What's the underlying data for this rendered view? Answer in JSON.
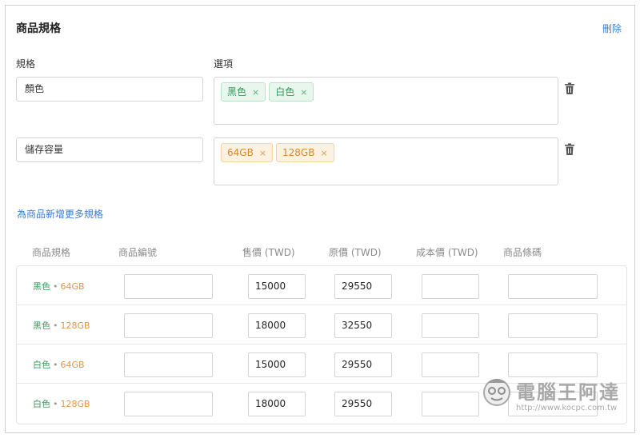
{
  "section": {
    "title": "商品規格",
    "delete_label": "刪除"
  },
  "labels": {
    "spec": "規格",
    "options": "選項"
  },
  "specs": [
    {
      "name": "顏色",
      "tags": [
        "黑色",
        "白色"
      ],
      "tag_color": "green"
    },
    {
      "name": "儲存容量",
      "tags": [
        "64GB",
        "128GB"
      ],
      "tag_color": "orange"
    }
  ],
  "tag_remove_glyph": "×",
  "add_more_label": "為商品新增更多規格",
  "table": {
    "headers": [
      "商品規格",
      "商品編號",
      "售價 (TWD)",
      "原價 (TWD)",
      "成本價 (TWD)",
      "商品條碼"
    ],
    "rows": [
      {
        "color": "黑色",
        "sep": "•",
        "storage": "64GB",
        "sku": "",
        "price": "15000",
        "original": "29550",
        "cost": "",
        "barcode": ""
      },
      {
        "color": "黑色",
        "sep": "•",
        "storage": "128GB",
        "sku": "",
        "price": "18000",
        "original": "32550",
        "cost": "",
        "barcode": ""
      },
      {
        "color": "白色",
        "sep": "•",
        "storage": "64GB",
        "sku": "",
        "price": "15000",
        "original": "29550",
        "cost": "",
        "barcode": ""
      },
      {
        "color": "白色",
        "sep": "•",
        "storage": "128GB",
        "sku": "",
        "price": "18000",
        "original": "29550",
        "cost": "",
        "barcode": ""
      }
    ]
  },
  "watermark": {
    "title": "電腦王阿達",
    "url": "http://www.kocpc.com.tw"
  },
  "colors": {
    "accent_link": "#3a7bd5",
    "tag_green": "#3a9a5b",
    "tag_orange": "#d6892a"
  },
  "icons": {
    "trash": "trash-icon",
    "remove": "close-icon"
  }
}
